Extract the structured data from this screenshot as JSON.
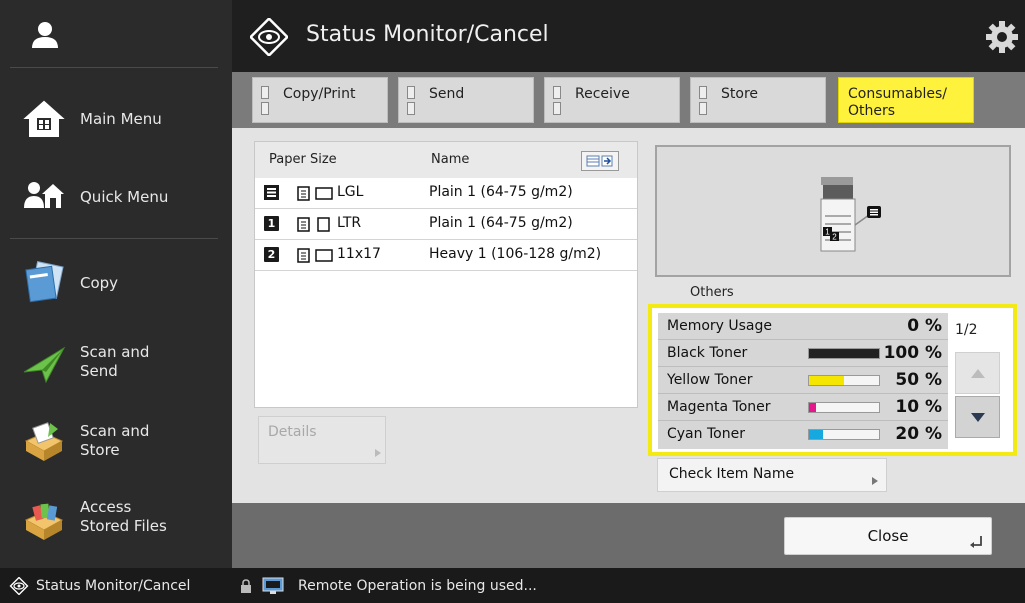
{
  "header": {
    "title": "Status Monitor/Cancel"
  },
  "sidebar": {
    "items": [
      {
        "label": "Main Menu",
        "icon": "home-icon"
      },
      {
        "label": "Quick Menu",
        "icon": "quick-menu-icon"
      },
      {
        "label": "Copy",
        "icon": "copy-icon"
      },
      {
        "label": "Scan and\nSend",
        "icon": "scan-send-icon"
      },
      {
        "label": "Scan and\nStore",
        "icon": "scan-store-icon"
      },
      {
        "label": "Access\nStored Files",
        "icon": "stored-files-icon"
      }
    ]
  },
  "tabs": [
    {
      "label": "Copy/Print"
    },
    {
      "label": "Send"
    },
    {
      "label": "Receive"
    },
    {
      "label": "Store"
    },
    {
      "label": "Consumables/\nOthers",
      "active": true
    }
  ],
  "paper": {
    "col_size": "Paper Size",
    "col_name": "Name",
    "rows": [
      {
        "num": "",
        "size": "LGL",
        "name": "Plain 1 (64-75 g/m2)"
      },
      {
        "num": "1",
        "size": "LTR",
        "name": "Plain 1 (64-75 g/m2)"
      },
      {
        "num": "2",
        "size": "11x17",
        "name": "Heavy 1 (106-128 g/m2)"
      }
    ]
  },
  "details_label": "Details",
  "others": {
    "label": "Others",
    "page": "1/2",
    "items": [
      {
        "label": "Memory Usage",
        "pct": "0 %",
        "value": 0,
        "color": ""
      },
      {
        "label": "Black Toner",
        "pct": "100 %",
        "value": 100,
        "color": "#222222"
      },
      {
        "label": "Yellow Toner",
        "pct": "50 %",
        "value": 50,
        "color": "#f4e600"
      },
      {
        "label": "Magenta Toner",
        "pct": "10 %",
        "value": 10,
        "color": "#e6178c"
      },
      {
        "label": "Cyan Toner",
        "pct": "20 %",
        "value": 20,
        "color": "#16a9e0"
      }
    ]
  },
  "check_item": "Check Item Name",
  "close_label": "Close",
  "statusbar": {
    "left": "Status Monitor/Cancel",
    "right": "Remote Operation is being used..."
  },
  "colors": {
    "highlight": "#fff23d",
    "panel_border": "#f2ea12"
  }
}
